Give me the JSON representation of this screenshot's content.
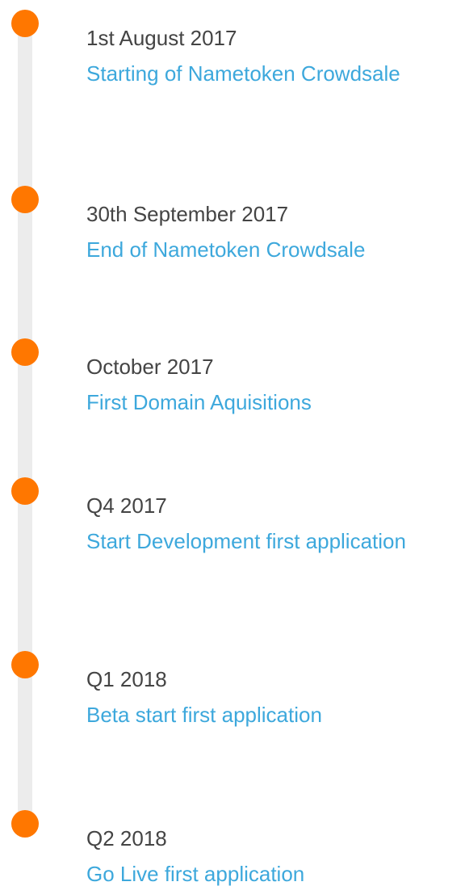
{
  "colors": {
    "dot": "#ff7700",
    "line": "#ececec",
    "date_text": "#444444",
    "description_text": "#3da8dc"
  },
  "milestones": [
    {
      "date": "1st August 2017",
      "description": "Starting of Nametoken Crowdsale"
    },
    {
      "date": "30th September 2017",
      "description": "End of Nametoken Crowdsale"
    },
    {
      "date": "October 2017",
      "description": "First Domain Aquisitions"
    },
    {
      "date": "Q4 2017",
      "description": "Start Development first application"
    },
    {
      "date": "Q1 2018",
      "description": "Beta start first application"
    },
    {
      "date": "Q2 2018",
      "description": "Go Live first application"
    }
  ]
}
